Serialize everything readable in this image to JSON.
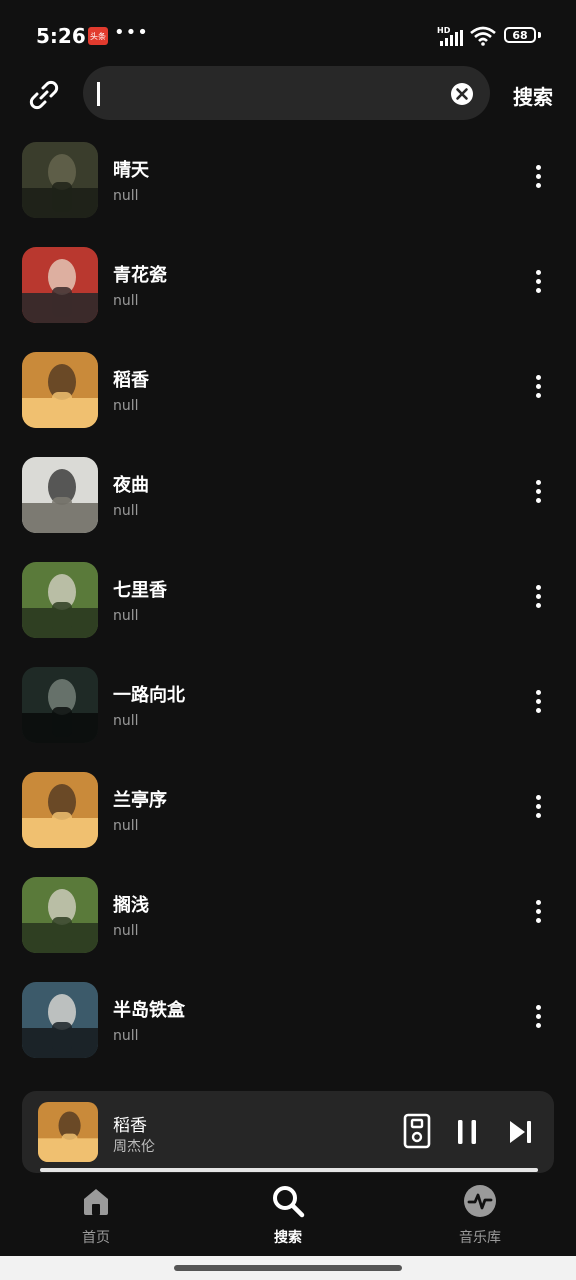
{
  "status_bar": {
    "time": "5:26",
    "app_badge": "头条",
    "more": "•••",
    "hd": "HD",
    "battery": "68"
  },
  "header": {
    "link_icon": "link-icon",
    "search_value": "",
    "clear_icon": "close-circle-icon",
    "search_button": "搜索"
  },
  "songs": [
    {
      "title": "晴天",
      "subtitle": "null",
      "cover_colors": [
        "#3a3d2c",
        "#6b6a52",
        "#1f2219"
      ]
    },
    {
      "title": "青花瓷",
      "subtitle": "null",
      "cover_colors": [
        "#b9382f",
        "#e9d7c7",
        "#3b2a2a"
      ]
    },
    {
      "title": "稻香",
      "subtitle": "null",
      "cover_colors": [
        "#c98a3a",
        "#4a3320",
        "#f0c070"
      ]
    },
    {
      "title": "夜曲",
      "subtitle": "null",
      "cover_colors": [
        "#dadad6",
        "#2a2a2a",
        "#7c7a72"
      ]
    },
    {
      "title": "七里香",
      "subtitle": "null",
      "cover_colors": [
        "#5a7a3a",
        "#d9d6c9",
        "#2f3f22"
      ]
    },
    {
      "title": "一路向北",
      "subtitle": "null",
      "cover_colors": [
        "#1f2a26",
        "#7f8a82",
        "#0c0f0e"
      ]
    },
    {
      "title": "兰亭序",
      "subtitle": "null",
      "cover_colors": [
        "#c98a3a",
        "#4a3320",
        "#f0c070"
      ]
    },
    {
      "title": "搁浅",
      "subtitle": "null",
      "cover_colors": [
        "#5a7a3a",
        "#d9d6c9",
        "#2f3f22"
      ]
    },
    {
      "title": "半岛铁盒",
      "subtitle": "null",
      "cover_colors": [
        "#3c5a6a",
        "#e7e3dc",
        "#1b2328"
      ]
    }
  ],
  "player": {
    "title": "稻香",
    "artist": "周杰伦",
    "progress": 1.0,
    "cover_colors": [
      "#c98a3a",
      "#4a3320",
      "#f0c070"
    ]
  },
  "nav": [
    {
      "label": "首页",
      "icon": "home-icon",
      "active": false
    },
    {
      "label": "搜索",
      "icon": "search-icon",
      "active": true
    },
    {
      "label": "音乐库",
      "icon": "pulse-icon",
      "active": false
    }
  ]
}
